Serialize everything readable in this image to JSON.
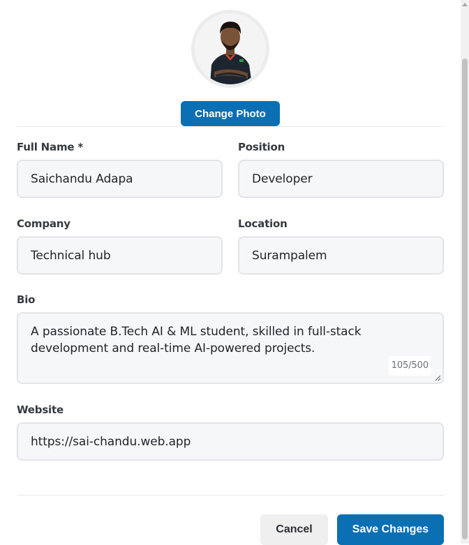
{
  "profile": {
    "avatar_alt": "Profile photo",
    "change_photo_label": "Change Photo"
  },
  "form": {
    "full_name": {
      "label": "Full Name *",
      "value": "Saichandu Adapa"
    },
    "position": {
      "label": "Position",
      "value": "Developer"
    },
    "company": {
      "label": "Company",
      "value": "Technical hub"
    },
    "location": {
      "label": "Location",
      "value": "Surampalem"
    },
    "bio": {
      "label": "Bio",
      "value": "A passionate B.Tech AI & ML student, skilled in full-stack development and real-time AI-powered projects.",
      "char_count": "105/500"
    },
    "website": {
      "label": "Website",
      "value": "https://sai-chandu.web.app"
    }
  },
  "actions": {
    "cancel_label": "Cancel",
    "save_label": "Save Changes"
  },
  "colors": {
    "primary": "#0a6fb3",
    "input_bg": "#f6f7f9",
    "input_border": "#e1e4e8",
    "cancel_bg": "#efefef"
  }
}
